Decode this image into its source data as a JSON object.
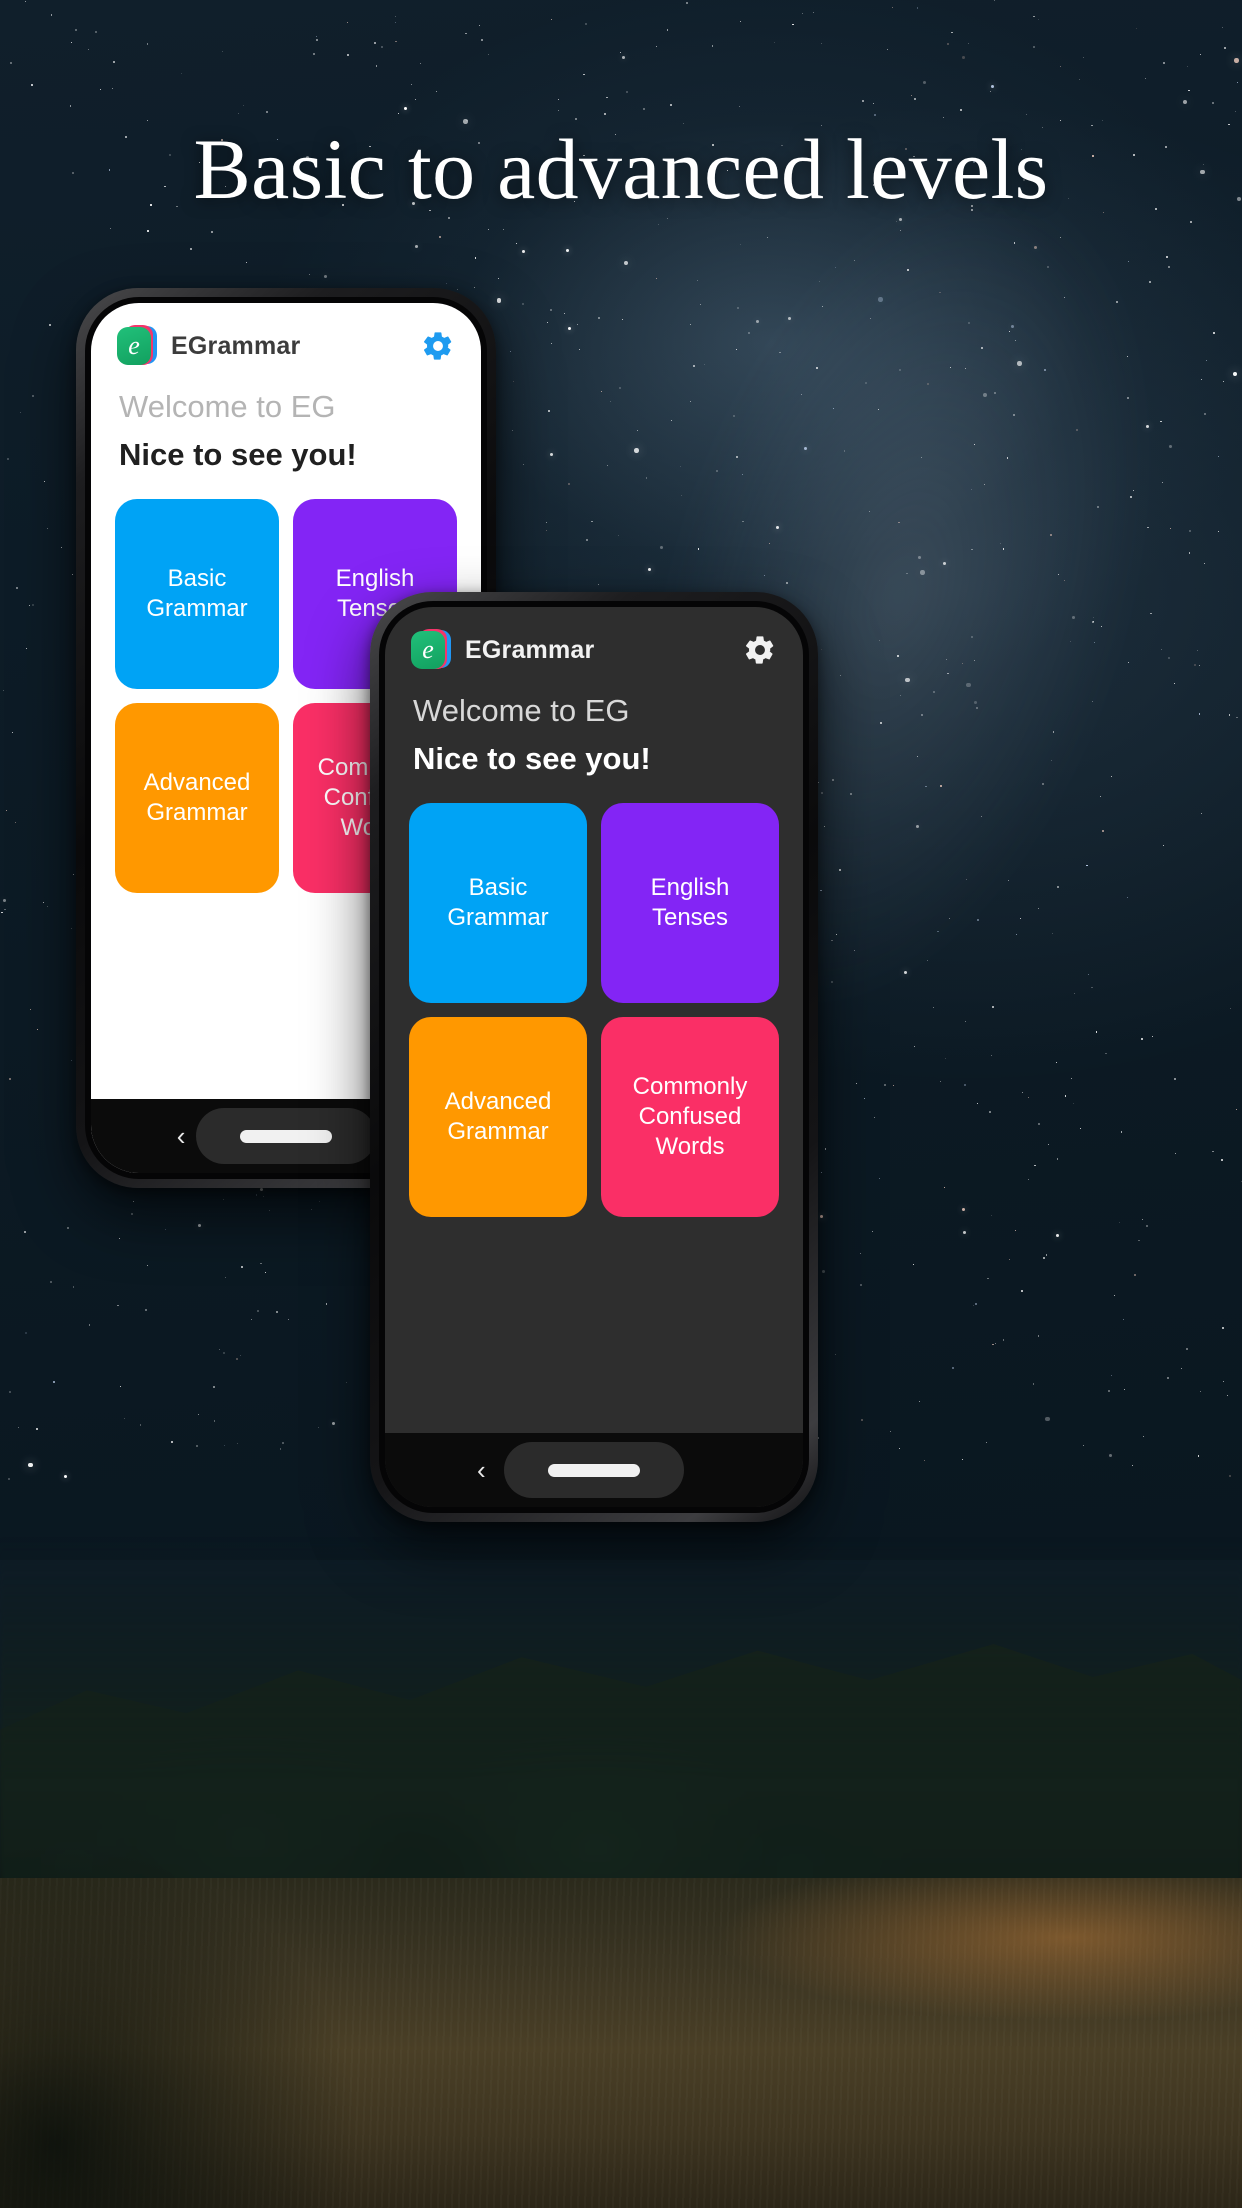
{
  "headline": "Basic to advanced levels",
  "colors": {
    "tile_blue": "#00A3F5",
    "tile_purple": "#8325F5",
    "tile_orange": "#FF9800",
    "tile_pink": "#FA2F66",
    "accent_gear_light": "#1E9BF0",
    "light_screen_bg": "#FFFFFF",
    "dark_screen_bg": "#2E2E2E"
  },
  "app": {
    "name": "EGrammar",
    "logo_icon": "egrammar-logo-icon",
    "settings_icon": "gear-icon",
    "welcome": "Welcome to EG",
    "greeting": "Nice to see you!",
    "tiles": [
      {
        "label": "Basic Grammar",
        "color": "#00A3F5"
      },
      {
        "label": "English Tenses",
        "color": "#8325F5"
      },
      {
        "label": "Advanced Grammar",
        "color": "#FF9800"
      },
      {
        "label": "Commonly Confused Words",
        "color": "#FA2F66"
      }
    ]
  },
  "navbar": {
    "back_icon": "chevron-left-icon",
    "back_label": "‹",
    "home_icon": "home-pill-icon"
  },
  "phones": [
    {
      "id": "phone-light",
      "theme": "light"
    },
    {
      "id": "phone-dark",
      "theme": "dark"
    }
  ]
}
